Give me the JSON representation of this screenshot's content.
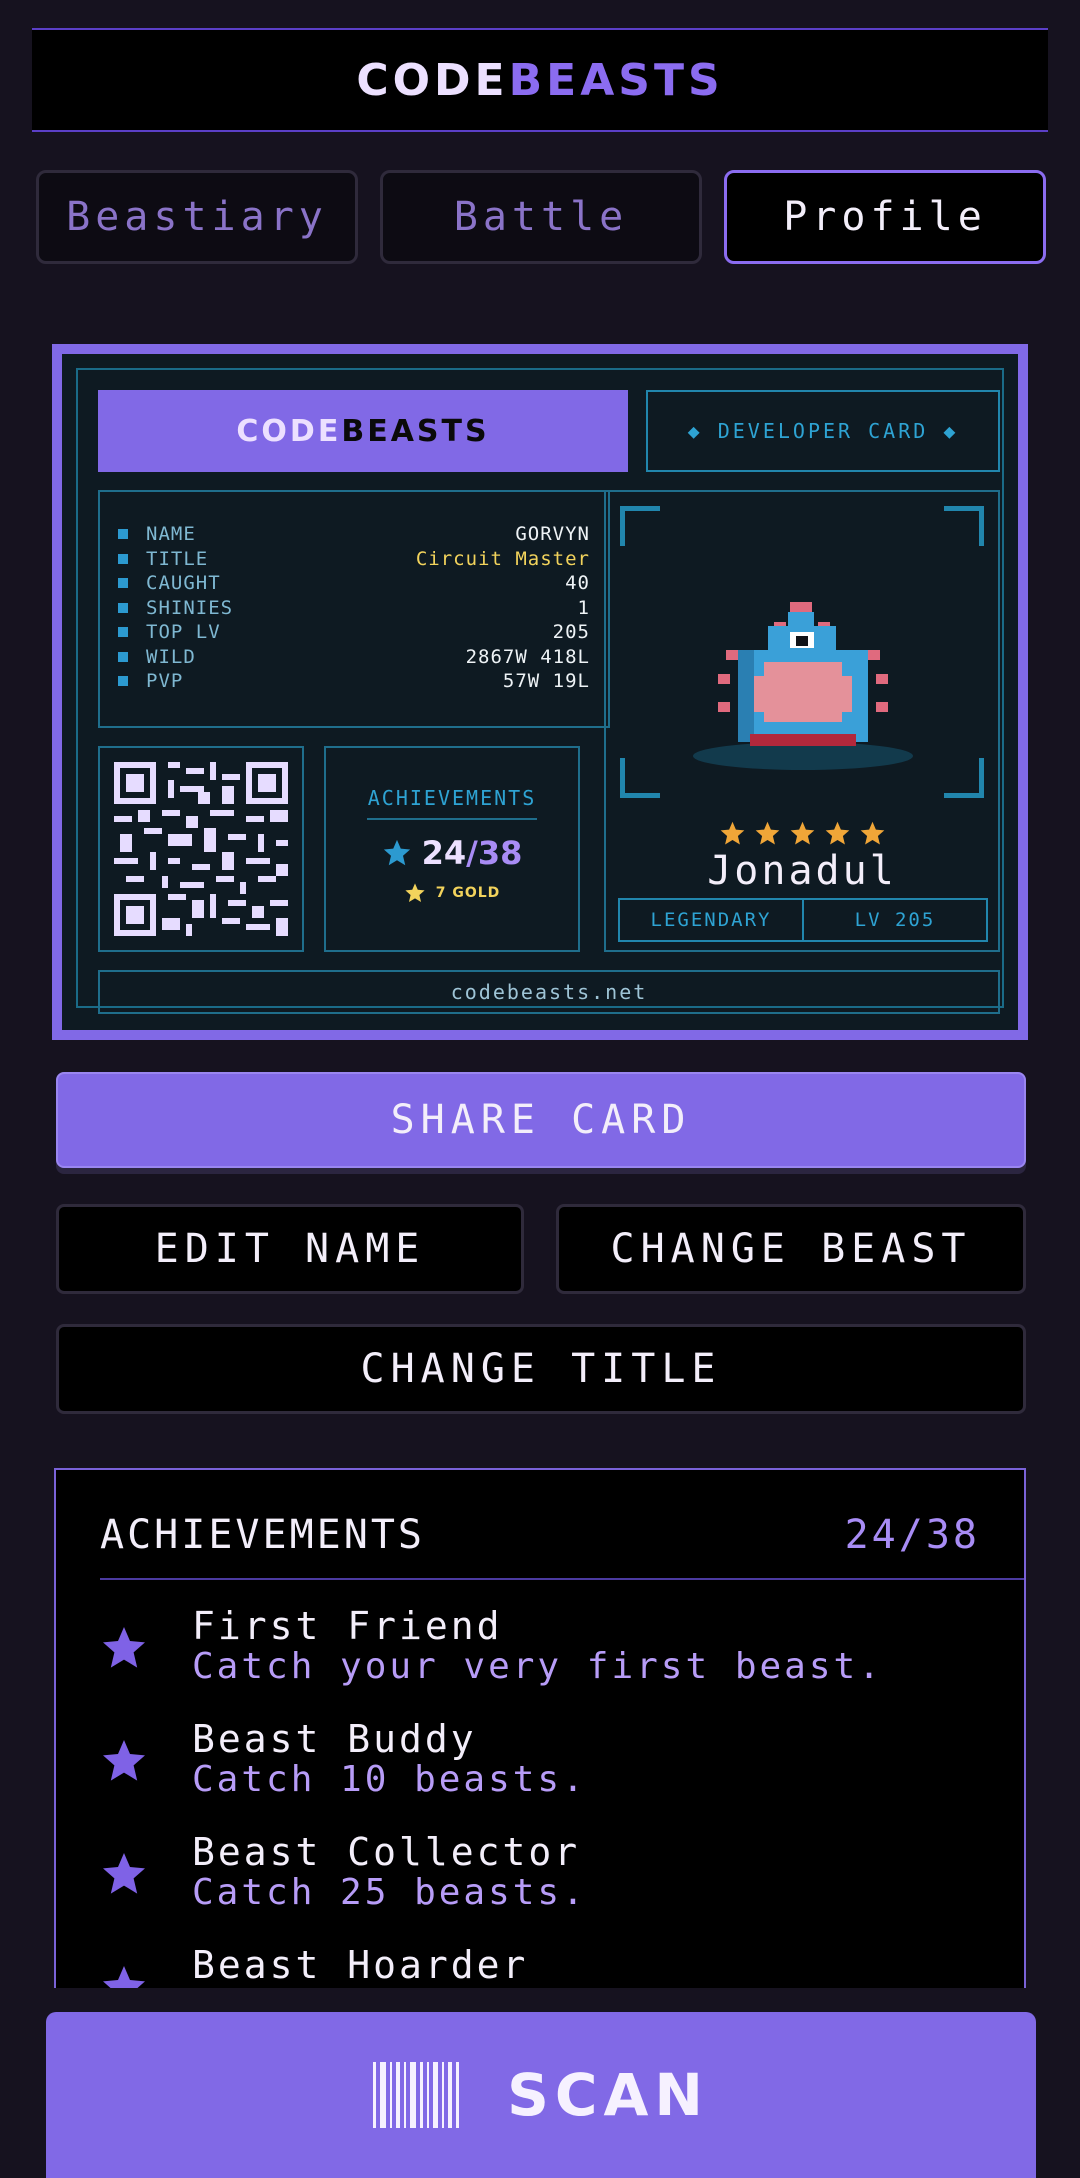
{
  "header": {
    "logo_part1": "CODE",
    "logo_part2": "BEASTS"
  },
  "tabs": [
    {
      "label": "Beastiary",
      "active": false
    },
    {
      "label": "Battle",
      "active": false
    },
    {
      "label": "Profile",
      "active": true
    }
  ],
  "card": {
    "brand_part1": "CODE",
    "brand_part2": "BEASTS",
    "developer_label": "◆ DEVELOPER CARD ◆",
    "stats": [
      {
        "label": "NAME",
        "value": "GORVYN"
      },
      {
        "label": "TITLE",
        "value": "Circuit Master"
      },
      {
        "label": "CAUGHT",
        "value": "40"
      },
      {
        "label": "SHINIES",
        "value": "1"
      },
      {
        "label": "TOP LV",
        "value": "205"
      },
      {
        "label": "WILD",
        "value": "2867W 418L"
      },
      {
        "label": "PVP",
        "value": "57W 19L"
      }
    ],
    "achievements": {
      "title": "ACHIEVEMENTS",
      "earned": "24",
      "total": "/38",
      "gold": "7 GOLD"
    },
    "beast": {
      "name": "Jonadul",
      "stars": 5,
      "rarity": "LEGENDARY",
      "level": "LV 205"
    },
    "url": "codebeasts.net"
  },
  "buttons": {
    "share": "SHARE CARD",
    "edit_name": "EDIT NAME",
    "change_beast": "CHANGE BEAST",
    "change_title": "CHANGE TITLE"
  },
  "achievement_list": {
    "title": "ACHIEVEMENTS",
    "count": "24/38",
    "items": [
      {
        "name": "First Friend",
        "desc": "Catch your very first beast."
      },
      {
        "name": "Beast Buddy",
        "desc": "Catch 10 beasts."
      },
      {
        "name": "Beast Collector",
        "desc": "Catch 25 beasts."
      },
      {
        "name": "Beast Hoarder",
        "desc": ""
      }
    ]
  },
  "scan": {
    "label": "SCAN",
    "icon": "barcode-icon"
  },
  "colors": {
    "accent": "#8169e6",
    "background": "#16121f",
    "card_dark": "#0e1a22",
    "gold": "#f2d35c",
    "cyan": "#2ea3d3"
  }
}
